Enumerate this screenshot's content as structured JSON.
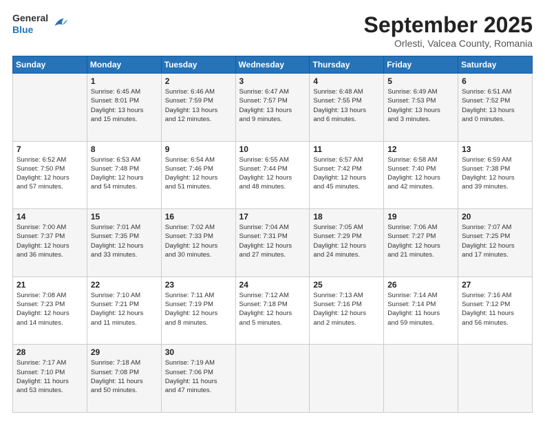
{
  "logo": {
    "general": "General",
    "blue": "Blue"
  },
  "header": {
    "month": "September 2025",
    "location": "Orlesti, Valcea County, Romania"
  },
  "days_of_week": [
    "Sunday",
    "Monday",
    "Tuesday",
    "Wednesday",
    "Thursday",
    "Friday",
    "Saturday"
  ],
  "weeks": [
    [
      {
        "day": "",
        "info": ""
      },
      {
        "day": "1",
        "info": "Sunrise: 6:45 AM\nSunset: 8:01 PM\nDaylight: 13 hours\nand 15 minutes."
      },
      {
        "day": "2",
        "info": "Sunrise: 6:46 AM\nSunset: 7:59 PM\nDaylight: 13 hours\nand 12 minutes."
      },
      {
        "day": "3",
        "info": "Sunrise: 6:47 AM\nSunset: 7:57 PM\nDaylight: 13 hours\nand 9 minutes."
      },
      {
        "day": "4",
        "info": "Sunrise: 6:48 AM\nSunset: 7:55 PM\nDaylight: 13 hours\nand 6 minutes."
      },
      {
        "day": "5",
        "info": "Sunrise: 6:49 AM\nSunset: 7:53 PM\nDaylight: 13 hours\nand 3 minutes."
      },
      {
        "day": "6",
        "info": "Sunrise: 6:51 AM\nSunset: 7:52 PM\nDaylight: 13 hours\nand 0 minutes."
      }
    ],
    [
      {
        "day": "7",
        "info": "Sunrise: 6:52 AM\nSunset: 7:50 PM\nDaylight: 12 hours\nand 57 minutes."
      },
      {
        "day": "8",
        "info": "Sunrise: 6:53 AM\nSunset: 7:48 PM\nDaylight: 12 hours\nand 54 minutes."
      },
      {
        "day": "9",
        "info": "Sunrise: 6:54 AM\nSunset: 7:46 PM\nDaylight: 12 hours\nand 51 minutes."
      },
      {
        "day": "10",
        "info": "Sunrise: 6:55 AM\nSunset: 7:44 PM\nDaylight: 12 hours\nand 48 minutes."
      },
      {
        "day": "11",
        "info": "Sunrise: 6:57 AM\nSunset: 7:42 PM\nDaylight: 12 hours\nand 45 minutes."
      },
      {
        "day": "12",
        "info": "Sunrise: 6:58 AM\nSunset: 7:40 PM\nDaylight: 12 hours\nand 42 minutes."
      },
      {
        "day": "13",
        "info": "Sunrise: 6:59 AM\nSunset: 7:38 PM\nDaylight: 12 hours\nand 39 minutes."
      }
    ],
    [
      {
        "day": "14",
        "info": "Sunrise: 7:00 AM\nSunset: 7:37 PM\nDaylight: 12 hours\nand 36 minutes."
      },
      {
        "day": "15",
        "info": "Sunrise: 7:01 AM\nSunset: 7:35 PM\nDaylight: 12 hours\nand 33 minutes."
      },
      {
        "day": "16",
        "info": "Sunrise: 7:02 AM\nSunset: 7:33 PM\nDaylight: 12 hours\nand 30 minutes."
      },
      {
        "day": "17",
        "info": "Sunrise: 7:04 AM\nSunset: 7:31 PM\nDaylight: 12 hours\nand 27 minutes."
      },
      {
        "day": "18",
        "info": "Sunrise: 7:05 AM\nSunset: 7:29 PM\nDaylight: 12 hours\nand 24 minutes."
      },
      {
        "day": "19",
        "info": "Sunrise: 7:06 AM\nSunset: 7:27 PM\nDaylight: 12 hours\nand 21 minutes."
      },
      {
        "day": "20",
        "info": "Sunrise: 7:07 AM\nSunset: 7:25 PM\nDaylight: 12 hours\nand 17 minutes."
      }
    ],
    [
      {
        "day": "21",
        "info": "Sunrise: 7:08 AM\nSunset: 7:23 PM\nDaylight: 12 hours\nand 14 minutes."
      },
      {
        "day": "22",
        "info": "Sunrise: 7:10 AM\nSunset: 7:21 PM\nDaylight: 12 hours\nand 11 minutes."
      },
      {
        "day": "23",
        "info": "Sunrise: 7:11 AM\nSunset: 7:19 PM\nDaylight: 12 hours\nand 8 minutes."
      },
      {
        "day": "24",
        "info": "Sunrise: 7:12 AM\nSunset: 7:18 PM\nDaylight: 12 hours\nand 5 minutes."
      },
      {
        "day": "25",
        "info": "Sunrise: 7:13 AM\nSunset: 7:16 PM\nDaylight: 12 hours\nand 2 minutes."
      },
      {
        "day": "26",
        "info": "Sunrise: 7:14 AM\nSunset: 7:14 PM\nDaylight: 11 hours\nand 59 minutes."
      },
      {
        "day": "27",
        "info": "Sunrise: 7:16 AM\nSunset: 7:12 PM\nDaylight: 11 hours\nand 56 minutes."
      }
    ],
    [
      {
        "day": "28",
        "info": "Sunrise: 7:17 AM\nSunset: 7:10 PM\nDaylight: 11 hours\nand 53 minutes."
      },
      {
        "day": "29",
        "info": "Sunrise: 7:18 AM\nSunset: 7:08 PM\nDaylight: 11 hours\nand 50 minutes."
      },
      {
        "day": "30",
        "info": "Sunrise: 7:19 AM\nSunset: 7:06 PM\nDaylight: 11 hours\nand 47 minutes."
      },
      {
        "day": "",
        "info": ""
      },
      {
        "day": "",
        "info": ""
      },
      {
        "day": "",
        "info": ""
      },
      {
        "day": "",
        "info": ""
      }
    ]
  ]
}
